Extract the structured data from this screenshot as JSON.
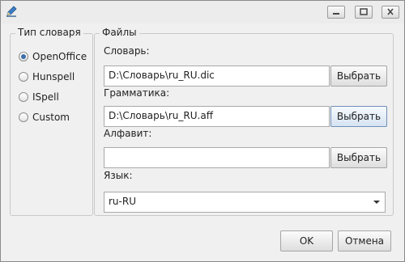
{
  "window": {
    "icon": "pencil-app-icon"
  },
  "dictionary_type": {
    "title": "Тип словаря",
    "options": [
      {
        "label": "OpenOffice",
        "checked": true
      },
      {
        "label": "Hunspell",
        "checked": false
      },
      {
        "label": "ISpell",
        "checked": false
      },
      {
        "label": "Custom",
        "checked": false
      }
    ]
  },
  "files": {
    "title": "Файлы",
    "dictionary": {
      "label": "Словарь:",
      "value": "D:\\Словарь\\ru_RU.dic",
      "button": "Выбрать"
    },
    "grammar": {
      "label": "Грамматика:",
      "value": "D:\\Словарь\\ru_RU.aff",
      "button": "Выбрать"
    },
    "alphabet": {
      "label": "Алфавит:",
      "value": "",
      "button": "Выбрать"
    },
    "language": {
      "label": "Язык:",
      "value": "ru-RU"
    }
  },
  "actions": {
    "ok": "OK",
    "cancel": "Отмена"
  },
  "colors": {
    "accent": "#3b6ea8",
    "window_bg": "#f0f0f0"
  }
}
